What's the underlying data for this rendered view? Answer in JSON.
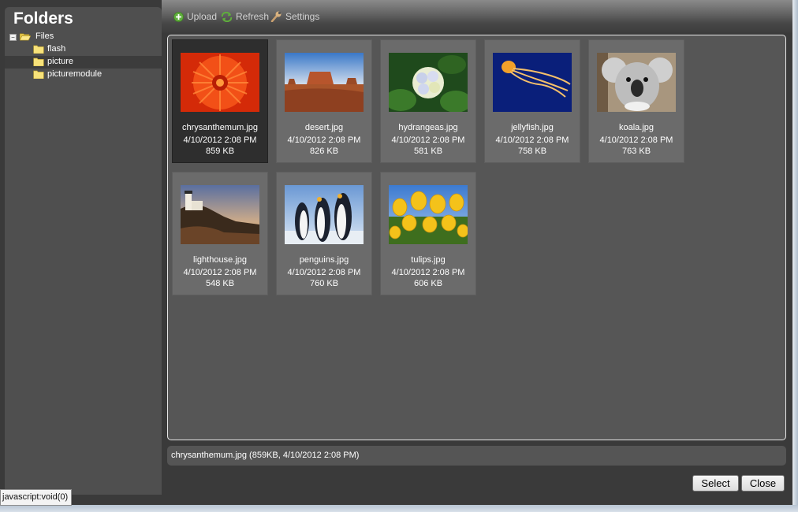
{
  "sidebar": {
    "title": "Folders",
    "tree": {
      "root": {
        "label": "Files",
        "expander": "−"
      },
      "children": [
        {
          "label": "flash"
        },
        {
          "label": "picture"
        },
        {
          "label": "picturemodule"
        }
      ]
    }
  },
  "toolbar": {
    "upload_label": "Upload",
    "refresh_label": "Refresh",
    "settings_label": "Settings"
  },
  "files": [
    {
      "name": "chrysanthemum.jpg",
      "date": "4/10/2012 2:08 PM",
      "size": "859 KB"
    },
    {
      "name": "desert.jpg",
      "date": "4/10/2012 2:08 PM",
      "size": "826 KB"
    },
    {
      "name": "hydrangeas.jpg",
      "date": "4/10/2012 2:08 PM",
      "size": "581 KB"
    },
    {
      "name": "jellyfish.jpg",
      "date": "4/10/2012 2:08 PM",
      "size": "758 KB"
    },
    {
      "name": "koala.jpg",
      "date": "4/10/2012 2:08 PM",
      "size": "763 KB"
    },
    {
      "name": "lighthouse.jpg",
      "date": "4/10/2012 2:08 PM",
      "size": "548 KB"
    },
    {
      "name": "penguins.jpg",
      "date": "4/10/2012 2:08 PM",
      "size": "760 KB"
    },
    {
      "name": "tulips.jpg",
      "date": "4/10/2012 2:08 PM",
      "size": "606 KB"
    }
  ],
  "status": {
    "selected_info": "chrysanthemum.jpg (859KB, 4/10/2012 2:08 PM)"
  },
  "buttons": {
    "select_label": "Select",
    "close_label": "Close"
  },
  "browser_status": {
    "text": "javascript:void(0)"
  },
  "colors": {
    "accent_green": "#5fae3c",
    "folder_yellow": "#f7e27a"
  }
}
